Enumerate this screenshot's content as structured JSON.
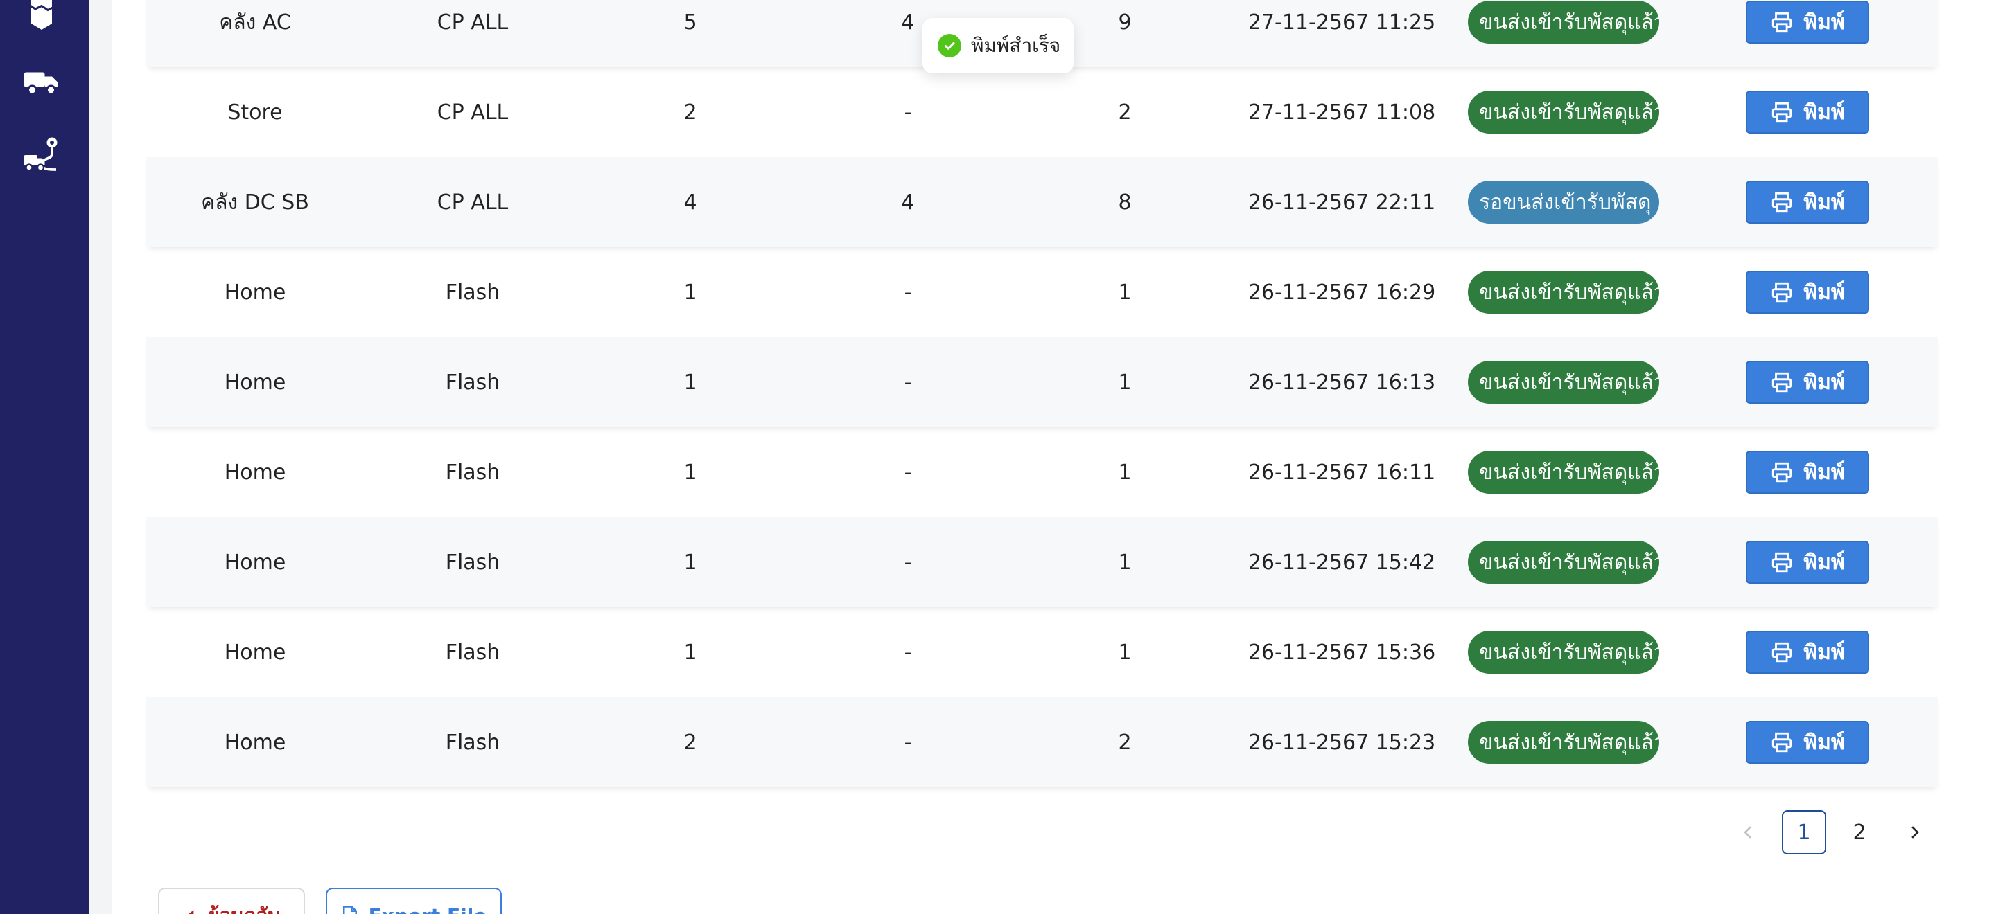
{
  "sidebar": {
    "icons": [
      "map-icon",
      "truck-icon",
      "route-truck-icon"
    ]
  },
  "toast": {
    "message": "พิมพ์สำเร็จ"
  },
  "table": {
    "rows": [
      {
        "location": "คลัง AC",
        "carrier": "CP ALL",
        "n1": "5",
        "n2": "4",
        "n3": "9",
        "datetime": "27-11-2567 11:25",
        "status": "ขนส่งเข้ารับพัสดุแล้ว",
        "status_type": "done",
        "action": "พิมพ์"
      },
      {
        "location": "Store",
        "carrier": "CP ALL",
        "n1": "2",
        "n2": "-",
        "n3": "2",
        "datetime": "27-11-2567 11:08",
        "status": "ขนส่งเข้ารับพัสดุแล้ว",
        "status_type": "done",
        "action": "พิมพ์"
      },
      {
        "location": "คลัง DC SB",
        "carrier": "CP ALL",
        "n1": "4",
        "n2": "4",
        "n3": "8",
        "datetime": "26-11-2567 22:11",
        "status": "รอขนส่งเข้ารับพัสดุ",
        "status_type": "wait",
        "action": "พิมพ์"
      },
      {
        "location": "Home",
        "carrier": "Flash",
        "n1": "1",
        "n2": "-",
        "n3": "1",
        "datetime": "26-11-2567 16:29",
        "status": "ขนส่งเข้ารับพัสดุแล้ว",
        "status_type": "done",
        "action": "พิมพ์"
      },
      {
        "location": "Home",
        "carrier": "Flash",
        "n1": "1",
        "n2": "-",
        "n3": "1",
        "datetime": "26-11-2567 16:13",
        "status": "ขนส่งเข้ารับพัสดุแล้ว",
        "status_type": "done",
        "action": "พิมพ์"
      },
      {
        "location": "Home",
        "carrier": "Flash",
        "n1": "1",
        "n2": "-",
        "n3": "1",
        "datetime": "26-11-2567 16:11",
        "status": "ขนส่งเข้ารับพัสดุแล้ว",
        "status_type": "done",
        "action": "พิมพ์"
      },
      {
        "location": "Home",
        "carrier": "Flash",
        "n1": "1",
        "n2": "-",
        "n3": "1",
        "datetime": "26-11-2567 15:42",
        "status": "ขนส่งเข้ารับพัสดุแล้ว",
        "status_type": "done",
        "action": "พิมพ์"
      },
      {
        "location": "Home",
        "carrier": "Flash",
        "n1": "1",
        "n2": "-",
        "n3": "1",
        "datetime": "26-11-2567 15:36",
        "status": "ขนส่งเข้ารับพัสดุแล้ว",
        "status_type": "done",
        "action": "พิมพ์"
      },
      {
        "location": "Home",
        "carrier": "Flash",
        "n1": "2",
        "n2": "-",
        "n3": "2",
        "datetime": "26-11-2567 15:23",
        "status": "ขนส่งเข้ารับพัสดุแล้ว",
        "status_type": "done",
        "action": "พิมพ์"
      }
    ]
  },
  "pagination": {
    "prev": "‹",
    "pages": [
      "1",
      "2"
    ],
    "current": "1",
    "next": "›"
  },
  "footer": {
    "back_label": "ย้อนกลับ",
    "export_label": "Export File"
  },
  "colors": {
    "sidebar": "#202263",
    "status_done": "#2e7d3e",
    "status_wait": "#3f86b3",
    "print_button": "#3a7fdc"
  }
}
